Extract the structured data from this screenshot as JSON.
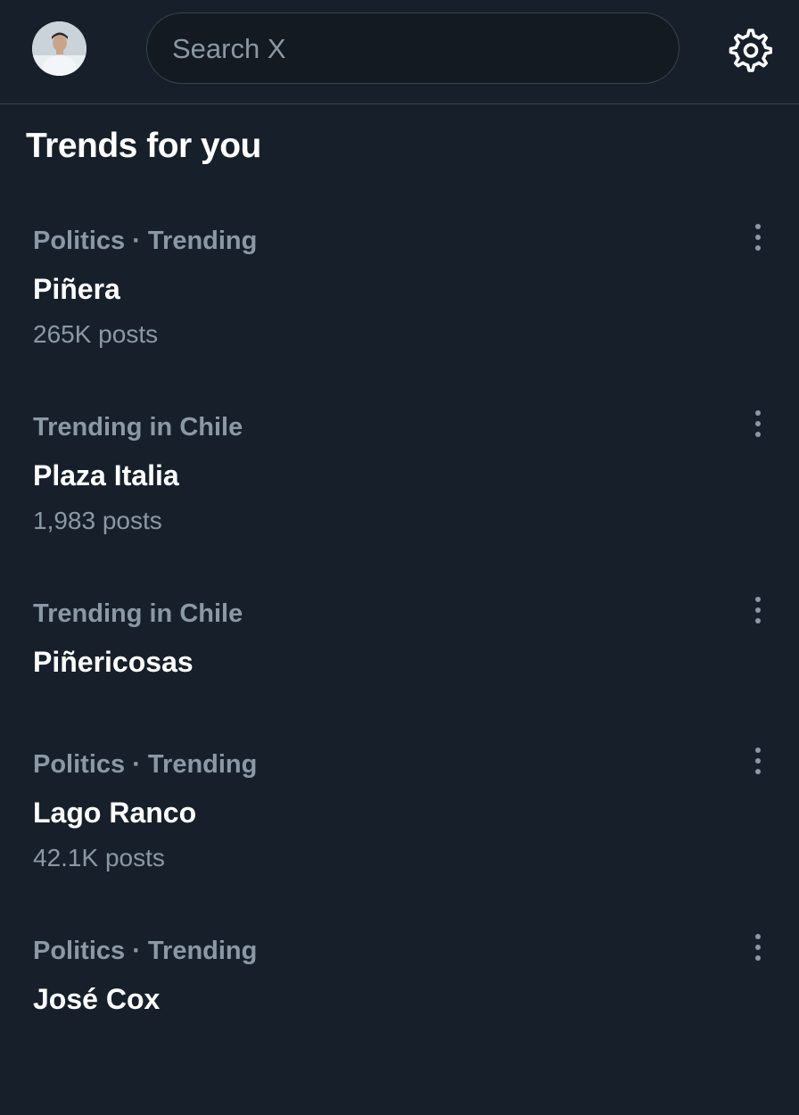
{
  "header": {
    "search_placeholder": "Search X",
    "avatar_icon": "user-avatar",
    "settings_icon": "gear-icon"
  },
  "section": {
    "title": "Trends for you"
  },
  "trends": [
    {
      "meta": "Politics · Trending",
      "name": "Piñera",
      "count": "265K posts"
    },
    {
      "meta": "Trending in Chile",
      "name": "Plaza Italia",
      "count": "1,983 posts"
    },
    {
      "meta": "Trending in Chile",
      "name": "Piñericosas",
      "count": ""
    },
    {
      "meta": "Politics · Trending",
      "name": "Lago Ranco",
      "count": "42.1K posts"
    },
    {
      "meta": "Politics · Trending",
      "name": "José Cox",
      "count": ""
    }
  ],
  "colors": {
    "background": "#17202a",
    "secondary_text": "#8b98a5",
    "border": "#38444d"
  }
}
